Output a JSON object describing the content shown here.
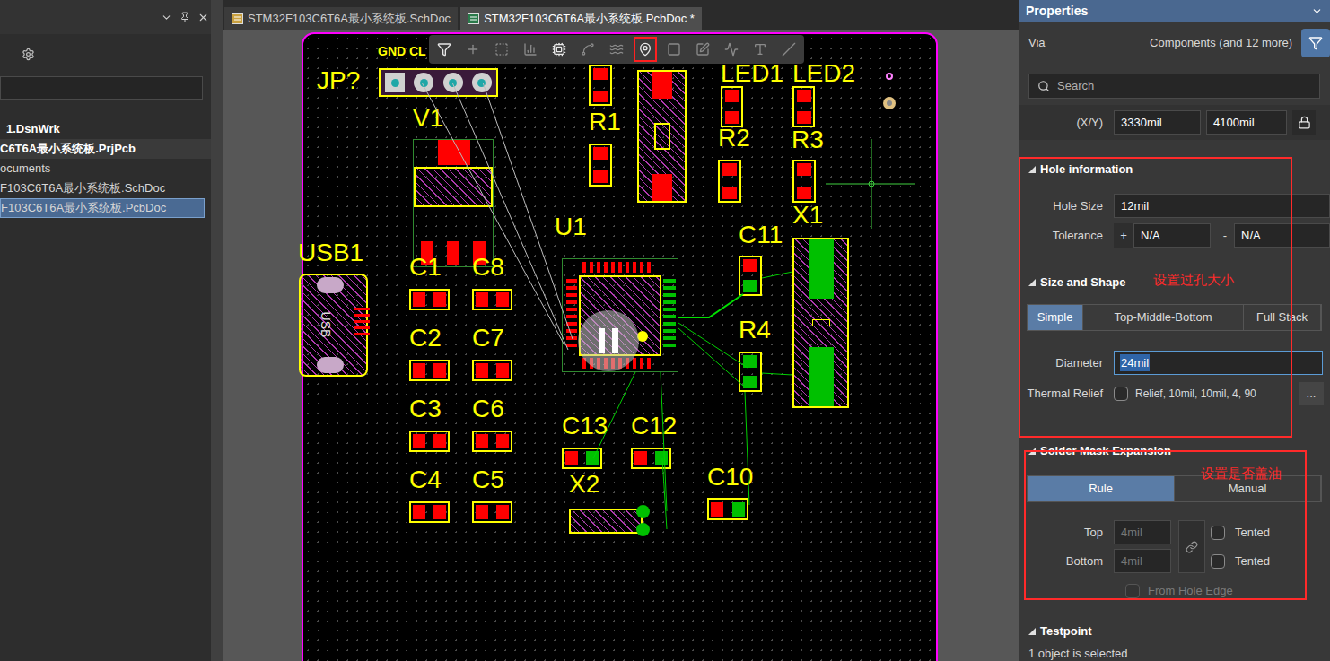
{
  "projects_panel": {
    "search": {
      "value": ""
    },
    "tree": [
      {
        "label": "1.DsnWrk",
        "bold": true,
        "selected": false
      },
      {
        "label": "C6T6A最小系统板.PrjPcb",
        "bold": true,
        "selected": false
      },
      {
        "label": "ocuments",
        "bold": false,
        "selected": false
      },
      {
        "label": "F103C6T6A最小系统板.SchDoc",
        "bold": false,
        "selected": false
      },
      {
        "label": "F103C6T6A最小系统板.PcbDoc",
        "bold": false,
        "selected": true
      }
    ]
  },
  "document_tabs": [
    {
      "label": "STM32F103C6T6A最小系统板.SchDoc",
      "kind": "schematic",
      "selected": false
    },
    {
      "label": "STM32F103C6T6A最小系统板.PcbDoc *",
      "kind": "pcb",
      "selected": true
    }
  ],
  "pcb": {
    "toolbar": [
      {
        "highlighted": false
      },
      {
        "highlighted": false
      },
      {
        "highlighted": false
      },
      {
        "highlighted": false
      },
      {
        "highlighted": false
      },
      {
        "highlighted": false
      },
      {
        "highlighted": false
      },
      {
        "highlighted": true
      },
      {
        "highlighted": false
      },
      {
        "highlighted": false
      },
      {
        "highlighted": false
      },
      {
        "highlighted": false
      },
      {
        "highlighted": false
      }
    ],
    "silkscreen": [
      {
        "text": "GND CL"
      }
    ],
    "components": [
      {
        "designator": "JP?",
        "pads": [
          "#d0d0d0",
          "#1fa7a7"
        ]
      },
      {
        "designator": "V1",
        "pads": [
          "#ff0000",
          "#ff0000"
        ]
      },
      {
        "designator": "LED1",
        "pads": [
          "#ff0000",
          "#ff0000"
        ]
      },
      {
        "designator": "LED2",
        "pads": [
          "#ff0000",
          "#ff0000"
        ]
      },
      {
        "designator": "R1",
        "pads": [
          "#ff0000",
          "#ff0000"
        ]
      },
      {
        "designator": "R2",
        "pads": [
          "#ff0000",
          "#ff0000"
        ]
      },
      {
        "designator": "R3",
        "pads": [
          "#ff0000",
          "#ff0000"
        ]
      },
      {
        "designator": "X1",
        "pads": [
          "#00c000",
          "#00c000"
        ]
      },
      {
        "designator": "USB1",
        "pads": [
          "#c8a8c8",
          "#ff0000"
        ],
        "body_text": "USB"
      },
      {
        "designator": "C1",
        "pads": [
          "#ff0000",
          "#ff0000"
        ]
      },
      {
        "designator": "C8",
        "pads": [
          "#ff0000",
          "#ff0000"
        ]
      },
      {
        "designator": "C2",
        "pads": [
          "#ff0000",
          "#ff0000"
        ]
      },
      {
        "designator": "C7",
        "pads": [
          "#ff0000",
          "#ff0000"
        ]
      },
      {
        "designator": "C3",
        "pads": [
          "#ff0000",
          "#ff0000"
        ]
      },
      {
        "designator": "C6",
        "pads": [
          "#ff0000",
          "#ff0000"
        ]
      },
      {
        "designator": "C4",
        "pads": [
          "#ff0000",
          "#ff0000"
        ]
      },
      {
        "designator": "C5",
        "pads": [
          "#ff0000",
          "#ff0000"
        ]
      },
      {
        "designator": "U1",
        "pads": [
          "#ff0000",
          "#00c000"
        ]
      },
      {
        "designator": "C11",
        "pads": [
          "#ff0000",
          "#00c000"
        ]
      },
      {
        "designator": "R4",
        "pads": [
          "#00c000",
          "#00c000"
        ]
      },
      {
        "designator": "C13",
        "pads": [
          "#ff0000",
          "#00c000"
        ]
      },
      {
        "designator": "C12",
        "pads": [
          "#ff0000",
          "#00c000"
        ]
      },
      {
        "designator": "X2",
        "pads": [
          "#00c000",
          "#00c000"
        ]
      },
      {
        "designator": "C10",
        "pads": [
          "#ff0000",
          "#00c000"
        ]
      }
    ]
  },
  "properties": {
    "title": "Properties",
    "object": "Via",
    "filter": "Components (and 12 more)",
    "search": {
      "placeholder": "Search"
    },
    "position": {
      "label": "(X/Y)",
      "x": "3330mil",
      "y": "4100mil",
      "locked": true
    },
    "hole_information": {
      "title": "Hole information",
      "expanded": true,
      "hole_size": {
        "label": "Hole Size",
        "value": "12mil"
      },
      "tolerance": {
        "label": "Tolerance",
        "plus": "+",
        "plus_value": "N/A",
        "minus": "-",
        "minus_value": "N/A"
      }
    },
    "size_and_shape": {
      "title": "Size and Shape",
      "expanded": true,
      "modes": [
        {
          "label": "Simple",
          "selected": true
        },
        {
          "label": "Top-Middle-Bottom",
          "selected": false
        },
        {
          "label": "Full Stack",
          "selected": false
        }
      ],
      "diameter": {
        "label": "Diameter",
        "value": "24mil",
        "focused": true
      },
      "thermal_relief": {
        "label": "Thermal Relief",
        "checked": false,
        "value": "Relief, 10mil, 10mil, 4, 90",
        "button": "..."
      }
    },
    "solder_mask_expansion": {
      "title": "Solder Mask Expansion",
      "expanded": true,
      "modes": [
        {
          "label": "Rule",
          "selected": true
        },
        {
          "label": "Manual",
          "selected": false
        }
      ],
      "rows": [
        {
          "label": "Top",
          "value": "4mil",
          "disabled": true,
          "tented_label": "Tented",
          "tented": false
        },
        {
          "label": "Bottom",
          "value": "4mil",
          "disabled": true,
          "tented_label": "Tented",
          "tented": false
        }
      ],
      "from_hole_edge": {
        "label": "From Hole Edge",
        "checked": false,
        "disabled": true
      }
    },
    "testpoint": {
      "title": "Testpoint",
      "expanded": true
    },
    "status": "1 object is selected"
  },
  "annotations": [
    {
      "text": "设置过孔大小",
      "color": "#ff2a2a"
    },
    {
      "text": "设置是否盖油",
      "color": "#ff2a2a"
    }
  ]
}
